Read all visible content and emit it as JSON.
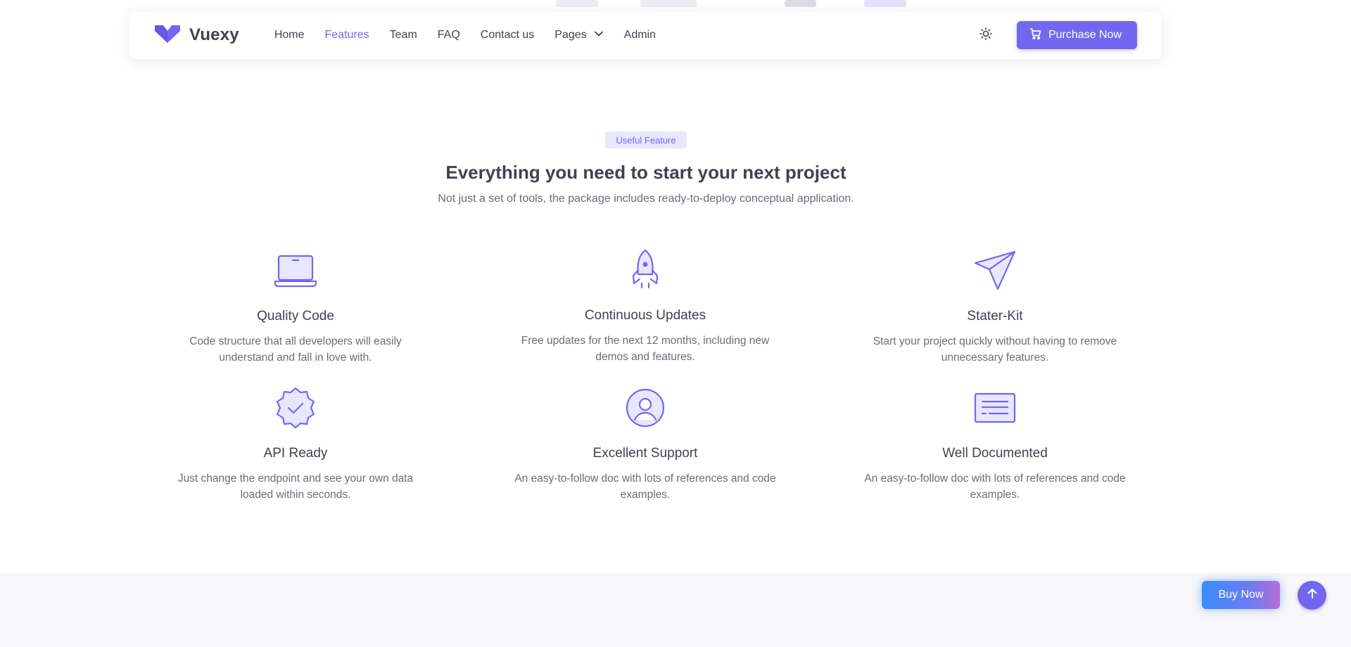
{
  "navbar": {
    "brand_name": "Vuexy",
    "links": [
      {
        "label": "Home",
        "active": false
      },
      {
        "label": "Features",
        "active": true
      },
      {
        "label": "Team",
        "active": false
      },
      {
        "label": "FAQ",
        "active": false
      },
      {
        "label": "Contact us",
        "active": false
      },
      {
        "label": "Pages",
        "active": false
      },
      {
        "label": "Admin",
        "active": false
      }
    ],
    "purchase_label": "Purchase Now",
    "icons": {
      "theme": "sun-icon",
      "cart": "cart-icon",
      "dropdown": "chevron-down-icon",
      "logo": "vuexy-logo-icon"
    }
  },
  "section": {
    "badge": "Useful Feature",
    "headline_highlight": "Everything you need",
    "headline_rest": " to start your next project",
    "subtitle": "Not just a set of tools, the package includes ready-to-deploy conceptual application."
  },
  "features": [
    {
      "title": "Quality Code",
      "desc": "Code structure that all developers will easily understand and fall in love with.",
      "icon": "laptop-icon"
    },
    {
      "title": "Continuous Updates",
      "desc": "Free updates for the next 12 months, including new demos and features.",
      "icon": "rocket-icon"
    },
    {
      "title": "Stater-Kit",
      "desc": "Start your project quickly without having to remove unnecessary features.",
      "icon": "paper-plane-icon"
    },
    {
      "title": "API Ready",
      "desc": "Just change the endpoint and see your own data loaded within seconds.",
      "icon": "check-badge-icon"
    },
    {
      "title": "Excellent Support",
      "desc": "An easy-to-follow doc with lots of references and code examples.",
      "icon": "user-circle-icon"
    },
    {
      "title": "Well Documented",
      "desc": "An easy-to-follow doc with lots of references and code examples.",
      "icon": "document-icon"
    }
  ],
  "floating": {
    "buy_now_label": "Buy Now",
    "scroll_top_icon": "arrow-up-icon"
  },
  "colors": {
    "primary": "#7367f0",
    "heading": "#444050",
    "body": "#6d6b77",
    "badge_bg": "#e9e7fd"
  }
}
